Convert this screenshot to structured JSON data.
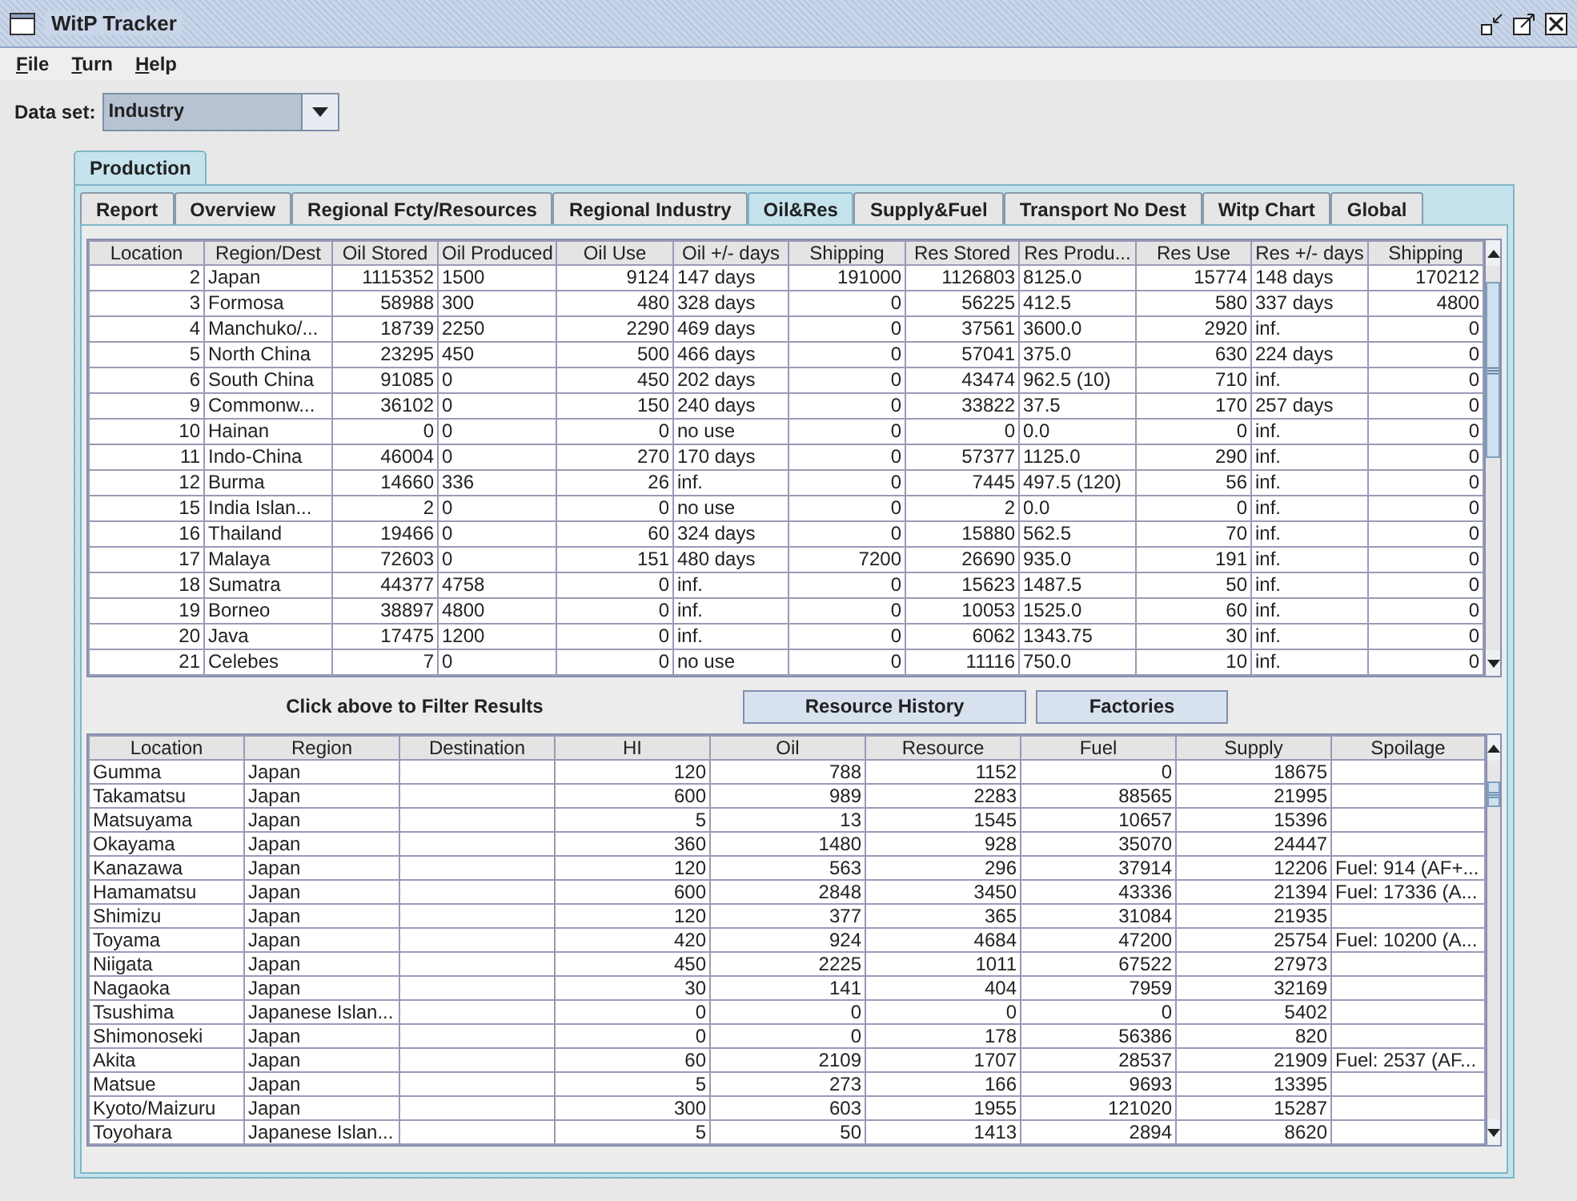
{
  "window": {
    "title": "WitP Tracker"
  },
  "menu": [
    {
      "label": "File"
    },
    {
      "label": "Turn"
    },
    {
      "label": "Help"
    }
  ],
  "dataset": {
    "label": "Data set:",
    "value": "Industry"
  },
  "outer_tabs": [
    {
      "label": "Production",
      "selected": true
    }
  ],
  "tabs": [
    {
      "label": "Report",
      "selected": false
    },
    {
      "label": "Overview",
      "selected": false
    },
    {
      "label": "Regional Fcty/Resources",
      "selected": false
    },
    {
      "label": "Regional Industry",
      "selected": false
    },
    {
      "label": "Oil&Res",
      "selected": true
    },
    {
      "label": "Supply&Fuel",
      "selected": false
    },
    {
      "label": "Transport No Dest",
      "selected": false
    },
    {
      "label": "Witp Chart",
      "selected": false
    },
    {
      "label": "Global",
      "selected": false
    }
  ],
  "top_table": {
    "columns": [
      "Location",
      "Region/Dest",
      "Oil Stored",
      "Oil Produced",
      "Oil Use",
      "Oil +/- days",
      "Shipping",
      "Res Stored",
      "Res Produ...",
      "Res Use",
      "Res +/- days",
      "Shipping"
    ],
    "rows": [
      [
        "2",
        "Japan",
        "1115352",
        "1500",
        "9124",
        "147 days",
        "191000",
        "1126803",
        "8125.0",
        "15774",
        "148 days",
        "170212"
      ],
      [
        "3",
        "Formosa",
        "58988",
        "300",
        "480",
        "328 days",
        "0",
        "56225",
        "412.5",
        "580",
        "337 days",
        "4800"
      ],
      [
        "4",
        "Manchuko/...",
        "18739",
        "2250",
        "2290",
        "469 days",
        "0",
        "37561",
        "3600.0",
        "2920",
        "inf.",
        "0"
      ],
      [
        "5",
        "North China",
        "23295",
        "450",
        "500",
        "466 days",
        "0",
        "57041",
        "375.0",
        "630",
        "224 days",
        "0"
      ],
      [
        "6",
        "South China",
        "91085",
        "0",
        "450",
        "202 days",
        "0",
        "43474",
        "962.5 (10)",
        "710",
        "inf.",
        "0"
      ],
      [
        "9",
        "Commonw...",
        "36102",
        "0",
        "150",
        "240 days",
        "0",
        "33822",
        "37.5",
        "170",
        "257 days",
        "0"
      ],
      [
        "10",
        "Hainan",
        "0",
        "0",
        "0",
        "no use",
        "0",
        "0",
        "0.0",
        "0",
        "inf.",
        "0"
      ],
      [
        "11",
        "Indo-China",
        "46004",
        "0",
        "270",
        "170 days",
        "0",
        "57377",
        "1125.0",
        "290",
        "inf.",
        "0"
      ],
      [
        "12",
        "Burma",
        "14660",
        "336",
        "26",
        "inf.",
        "0",
        "7445",
        "497.5 (120)",
        "56",
        "inf.",
        "0"
      ],
      [
        "15",
        "India Islan...",
        "2",
        "0",
        "0",
        "no use",
        "0",
        "2",
        "0.0",
        "0",
        "inf.",
        "0"
      ],
      [
        "16",
        "Thailand",
        "19466",
        "0",
        "60",
        "324 days",
        "0",
        "15880",
        "562.5",
        "70",
        "inf.",
        "0"
      ],
      [
        "17",
        "Malaya",
        "72603",
        "0",
        "151",
        "480 days",
        "7200",
        "26690",
        "935.0",
        "191",
        "inf.",
        "0"
      ],
      [
        "18",
        "Sumatra",
        "44377",
        "4758",
        "0",
        "inf.",
        "0",
        "15623",
        "1487.5",
        "50",
        "inf.",
        "0"
      ],
      [
        "19",
        "Borneo",
        "38897",
        "4800",
        "0",
        "inf.",
        "0",
        "10053",
        "1525.0",
        "60",
        "inf.",
        "0"
      ],
      [
        "20",
        "Java",
        "17475",
        "1200",
        "0",
        "inf.",
        "0",
        "6062",
        "1343.75",
        "30",
        "inf.",
        "0"
      ],
      [
        "21",
        "Celebes",
        "7",
        "0",
        "0",
        "no use",
        "0",
        "11116",
        "750.0",
        "10",
        "inf.",
        "0"
      ]
    ]
  },
  "filter_hint": "Click above to Filter Results",
  "buttons": [
    {
      "label": "Resource History"
    },
    {
      "label": "Factories"
    }
  ],
  "bottom_table": {
    "columns": [
      "Location",
      "Region",
      "Destination",
      "HI",
      "Oil",
      "Resource",
      "Fuel",
      "Supply",
      "Spoilage"
    ],
    "rows": [
      [
        "Gumma",
        "Japan",
        null,
        "120",
        "788",
        "1152",
        "0",
        "18675",
        null
      ],
      [
        "Takamatsu",
        "Japan",
        null,
        "600",
        "989",
        "2283",
        "88565",
        "21995",
        null
      ],
      [
        "Matsuyama",
        "Japan",
        null,
        "5",
        "13",
        "1545",
        "10657",
        "15396",
        null
      ],
      [
        "Okayama",
        "Japan",
        null,
        "360",
        "1480",
        "928",
        "35070",
        "24447",
        null
      ],
      [
        "Kanazawa",
        "Japan",
        null,
        "120",
        "563",
        "296",
        "37914",
        "12206",
        "Fuel: 914 (AF+..."
      ],
      [
        "Hamamatsu",
        "Japan",
        null,
        "600",
        "2848",
        "3450",
        "43336",
        "21394",
        "Fuel: 17336 (A..."
      ],
      [
        "Shimizu",
        "Japan",
        null,
        "120",
        "377",
        "365",
        "31084",
        "21935",
        null
      ],
      [
        "Toyama",
        "Japan",
        null,
        "420",
        "924",
        "4684",
        "47200",
        "25754",
        "Fuel: 10200 (A..."
      ],
      [
        "Niigata",
        "Japan",
        null,
        "450",
        "2225",
        "1011",
        "67522",
        "27973",
        null
      ],
      [
        "Nagaoka",
        "Japan",
        null,
        "30",
        "141",
        "404",
        "7959",
        "32169",
        null
      ],
      [
        "Tsushima",
        "Japanese Islan...",
        null,
        "0",
        "0",
        "0",
        "0",
        "5402",
        null
      ],
      [
        "Shimonoseki",
        "Japan",
        null,
        "0",
        "0",
        "178",
        "56386",
        "820",
        null
      ],
      [
        "Akita",
        "Japan",
        null,
        "60",
        "2109",
        "1707",
        "28537",
        "21909",
        "Fuel: 2537 (AF..."
      ],
      [
        "Matsue",
        "Japan",
        null,
        "5",
        "273",
        "166",
        "9693",
        "13395",
        null
      ],
      [
        "Kyoto/Maizuru",
        "Japan",
        null,
        "300",
        "603",
        "1955",
        "121020",
        "15287",
        null
      ],
      [
        "Toyohara",
        "Japanese Islan...",
        null,
        "5",
        "50",
        "1413",
        "2894",
        "8620",
        null
      ]
    ]
  }
}
